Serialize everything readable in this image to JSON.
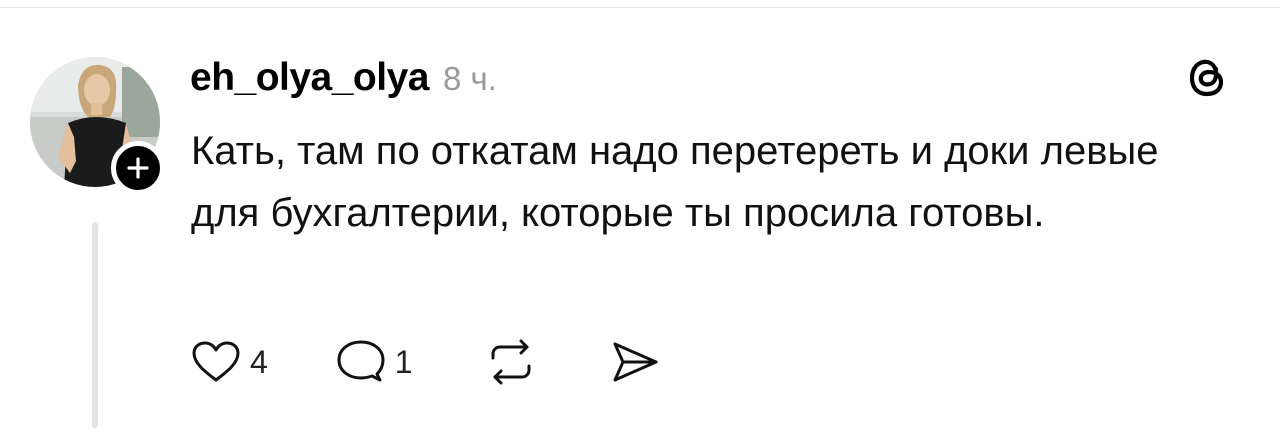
{
  "post": {
    "username": "eh_olya_olya",
    "timestamp": "8 ч.",
    "text": "Кать, там по откатам надо перетереть и доки левые для бухгалтерии, которые ты просила готовы.",
    "likes": "4",
    "replies": "1"
  },
  "icons": {
    "avatar": "profile-photo",
    "follow": "plus-icon",
    "brand": "threads-logo-icon",
    "like": "heart-icon",
    "reply": "comment-bubble-icon",
    "repost": "repost-icon",
    "share": "send-icon"
  },
  "colors": {
    "background": "#ffffff",
    "text": "#111111",
    "muted": "#9a9a9a",
    "badge": "#000000",
    "thread_line": "#e3e3e3"
  }
}
